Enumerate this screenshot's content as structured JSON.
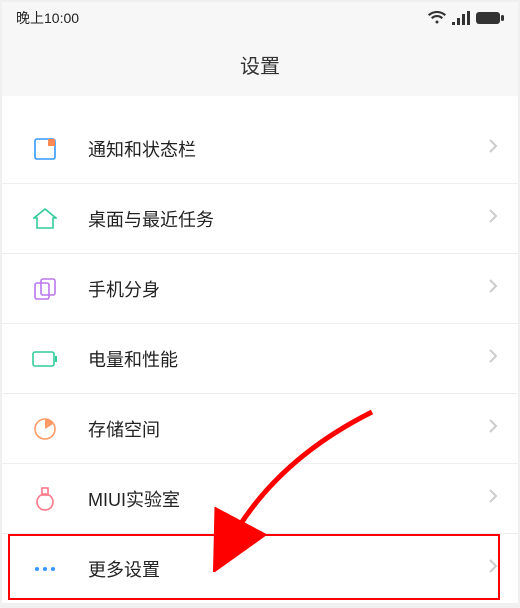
{
  "status_bar": {
    "time": "晚上10:00"
  },
  "header": {
    "title": "设置"
  },
  "list": {
    "items": [
      {
        "icon": "notification-icon",
        "label": "通知和状态栏"
      },
      {
        "icon": "home-icon",
        "label": "桌面与最近任务"
      },
      {
        "icon": "clone-icon",
        "label": "手机分身"
      },
      {
        "icon": "battery-icon",
        "label": "电量和性能"
      },
      {
        "icon": "storage-icon",
        "label": "存储空间"
      },
      {
        "icon": "lab-icon",
        "label": "MIUI实验室"
      },
      {
        "icon": "more-icon",
        "label": "更多设置"
      }
    ]
  },
  "annotation": {
    "highlight_index": 6
  }
}
